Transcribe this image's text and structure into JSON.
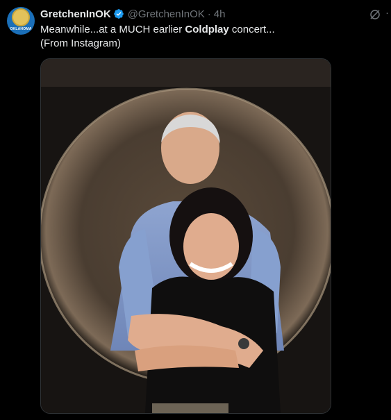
{
  "tweet": {
    "author_name": "GretchenInOK",
    "author_handle": "@GretchenInOK",
    "separator": "·",
    "time": "4h",
    "avatar_text": "OKLAHOMA",
    "text_part1": "Meanwhile...at a MUCH earlier ",
    "text_bold": "Coldplay",
    "text_part2": " concert...",
    "text_line2": "(From Instagram)",
    "more_label": "·",
    "media_description": "photo"
  },
  "icons": {
    "verified": "verified-badge-icon",
    "grok": "grok-icon",
    "more": "more-icon"
  },
  "colors": {
    "background": "#000000",
    "text": "#e7e9ea",
    "secondary": "#71767b",
    "verified": "#1d9bf0"
  }
}
